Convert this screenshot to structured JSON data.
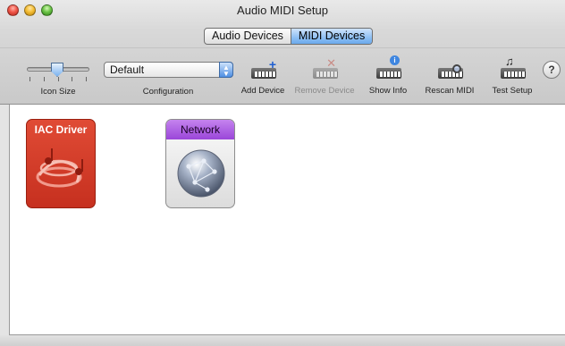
{
  "window": {
    "title": "Audio MIDI Setup"
  },
  "tabs": [
    {
      "label": "Audio Devices",
      "selected": false
    },
    {
      "label": "MIDI Devices",
      "selected": true
    }
  ],
  "toolbar": {
    "icon_size_label": "Icon Size",
    "icon_size_value": 0.45,
    "configuration_label": "Configuration",
    "configuration_value": "Default",
    "add_device_label": "Add Device",
    "remove_device_label": "Remove Device",
    "remove_device_enabled": false,
    "show_info_label": "Show Info",
    "rescan_midi_label": "Rescan MIDI",
    "test_setup_label": "Test Setup",
    "help_label": "?"
  },
  "devices": [
    {
      "name": "IAC Driver",
      "icon": "midi-music-notes-icon",
      "color": "#d43a27"
    },
    {
      "name": "Network",
      "icon": "network-globe-icon",
      "color": "#a957df"
    }
  ]
}
